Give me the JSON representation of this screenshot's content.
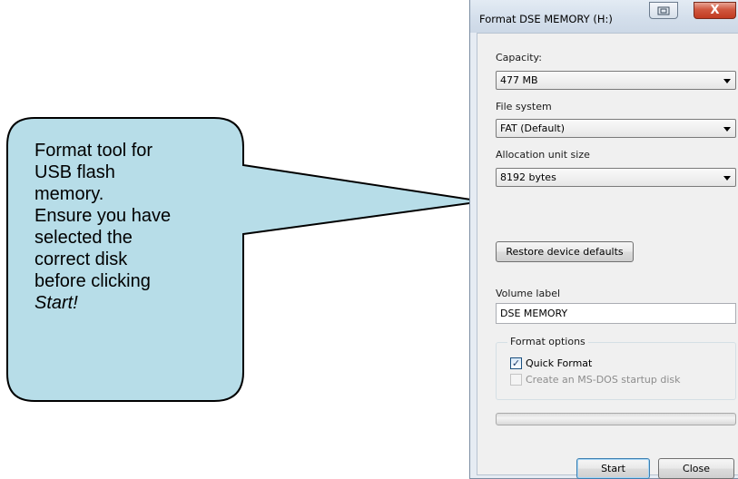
{
  "callout": {
    "lines": [
      "Format tool for",
      "USB flash",
      "memory.",
      "Ensure you have",
      "selected the",
      "correct disk",
      "before clicking"
    ],
    "emphasis": "Start!",
    "fill": "#b7dde8",
    "stroke": "#000000"
  },
  "dialog": {
    "title": "Format DSE MEMORY (H:)",
    "titlebar_buttons": {
      "restore_icon": "restore-window-icon",
      "close_symbol": "X",
      "close_color": "#c8442b"
    },
    "capacity": {
      "label": "Capacity:",
      "value": "477 MB"
    },
    "file_system": {
      "label": "File system",
      "value": "FAT (Default)"
    },
    "allocation": {
      "label": "Allocation unit size",
      "value": "8192 bytes"
    },
    "restore_defaults_label": "Restore device defaults",
    "volume": {
      "label": "Volume label",
      "value": "DSE MEMORY"
    },
    "format_options": {
      "title": "Format options",
      "quick_format": {
        "label": "Quick Format",
        "checked": true,
        "enabled": true
      },
      "msdos_disk": {
        "label": "Create an MS-DOS startup disk",
        "checked": false,
        "enabled": false
      }
    },
    "progress": 0,
    "start_label": "Start",
    "close_label": "Close"
  }
}
